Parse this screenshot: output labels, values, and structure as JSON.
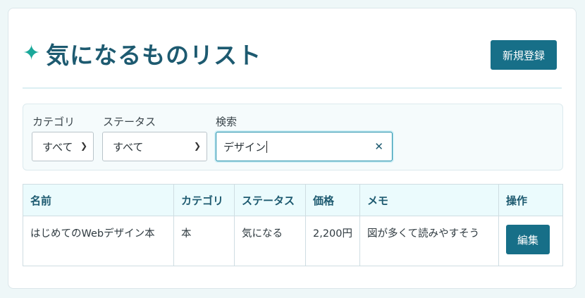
{
  "header": {
    "title": "気になるものリスト",
    "new_button": "新規登録"
  },
  "filters": {
    "category_label": "カテゴリ",
    "category_value": "すべて",
    "status_label": "ステータス",
    "status_value": "すべて",
    "search_label": "検索",
    "search_value": "デザイン"
  },
  "table": {
    "headers": [
      "名前",
      "カテゴリ",
      "ステータス",
      "価格",
      "メモ",
      "操作"
    ],
    "rows": [
      {
        "name": "はじめてのWebデザイン本",
        "category": "本",
        "status": "気になる",
        "price": "2,200円",
        "memo": "図が多くて読みやすそう",
        "action": "編集"
      }
    ]
  },
  "colors": {
    "accent": "#176f88",
    "title": "#1d5a70",
    "sparkle": "#1aa89a"
  },
  "icons": {
    "title_icon": "sparkle-icon",
    "select_icon": "chevron-down-icon",
    "clear_icon": "close-icon"
  }
}
